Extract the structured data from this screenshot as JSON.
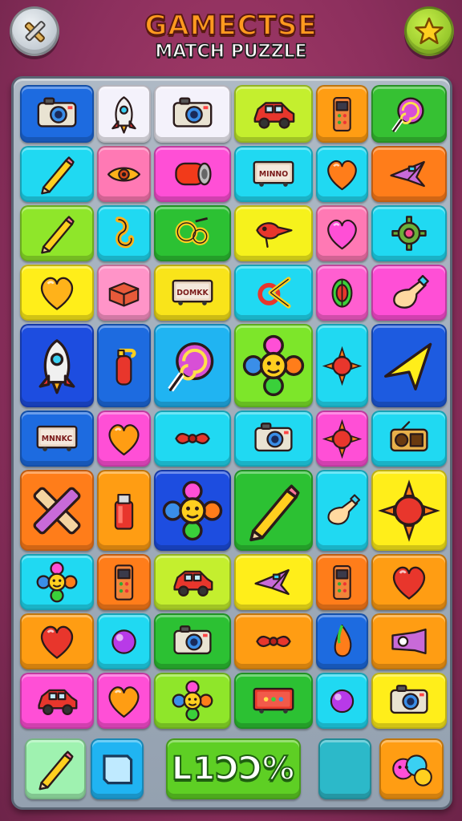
{
  "header": {
    "title": "GAMECTSE",
    "subtitle": "MATCH PUZZLE",
    "left_button_icon": "tools-icon",
    "right_button_icon": "star-icon"
  },
  "board": {
    "rows": [
      [
        {
          "icon": "camera-icon",
          "color": "#1d6be0"
        },
        {
          "icon": "rocket-icon",
          "color": "#f4f2fb"
        },
        {
          "icon": "camera-icon",
          "color": "#f4f2fb"
        },
        {
          "icon": "car-icon",
          "color": "#c4ef2e"
        },
        {
          "icon": "remote-icon",
          "color": "#ff9d13"
        },
        {
          "icon": "lollipop-icon",
          "color": "#36c133"
        }
      ],
      [
        {
          "icon": "pencil-icon",
          "color": "#20d9f2"
        },
        {
          "icon": "eye-icon",
          "color": "#ff79b4"
        },
        {
          "icon": "barrel-icon",
          "color": "#ff4fd6"
        },
        {
          "icon": "sign-icon",
          "color": "#20d9f2",
          "text": "MINNO"
        },
        {
          "icon": "heart-icon",
          "color": "#20d9f2"
        },
        {
          "icon": "plane-icon",
          "color": "#ff7d1a"
        }
      ],
      [
        {
          "icon": "pencil-icon",
          "color": "#8fe62a"
        },
        {
          "icon": "hook-icon",
          "color": "#20d9f2"
        },
        {
          "icon": "gears-icon",
          "color": "#2cc133"
        },
        {
          "icon": "bird-icon",
          "color": "#f6f21c"
        },
        {
          "icon": "heart-icon",
          "color": "#ff79b4"
        },
        {
          "icon": "gear-icon",
          "color": "#20d9f2"
        }
      ],
      [
        {
          "icon": "heart-icon",
          "color": "#ffee1a"
        },
        {
          "icon": "box-icon",
          "color": "#ff94c8"
        },
        {
          "icon": "sign-icon",
          "color": "#f9e41a",
          "text": "DOMKK"
        },
        {
          "icon": "pliers-icon",
          "color": "#20d9f2"
        },
        {
          "icon": "leaf-icon",
          "color": "#ff5fd0"
        },
        {
          "icon": "bottle-icon",
          "color": "#ff4fd6"
        }
      ],
      [
        {
          "icon": "rocket-icon",
          "color": "#1d4de0"
        },
        {
          "icon": "extinguisher-icon",
          "color": "#1d6be0"
        },
        {
          "icon": "lollipop-icon",
          "color": "#20b4f2"
        },
        {
          "icon": "flower-icon",
          "color": "#7de62a"
        },
        {
          "icon": "sun-icon",
          "color": "#20d9f2"
        },
        {
          "icon": "arrow-icon",
          "color": "#1d5be0"
        }
      ],
      [
        {
          "icon": "sign-icon",
          "color": "#1d6be0",
          "text": "MNNKC"
        },
        {
          "icon": "heart-icon",
          "color": "#ff4fd6"
        },
        {
          "icon": "bow-icon",
          "color": "#20d9f2"
        },
        {
          "icon": "camera-icon",
          "color": "#20d9f2"
        },
        {
          "icon": "sun-icon",
          "color": "#ff4fd6"
        },
        {
          "icon": "radio-icon",
          "color": "#20d9f2"
        }
      ],
      [
        {
          "icon": "tools-icon",
          "color": "#ff7d1a"
        },
        {
          "icon": "lighter-icon",
          "color": "#ff9d13"
        },
        {
          "icon": "flower-icon",
          "color": "#1d4de0"
        },
        {
          "icon": "pencil-icon",
          "color": "#2cc133"
        },
        {
          "icon": "bottle-icon",
          "color": "#20d9f2"
        },
        {
          "icon": "sun-icon",
          "color": "#ffee1a"
        }
      ],
      [
        {
          "icon": "flower-icon",
          "color": "#20d9f2"
        },
        {
          "icon": "remote-icon",
          "color": "#ff7d1a"
        },
        {
          "icon": "car-icon",
          "color": "#c4ef2e"
        },
        {
          "icon": "plane-icon",
          "color": "#ffee1a"
        },
        {
          "icon": "remote-icon",
          "color": "#ff7d1a"
        },
        {
          "icon": "heart-icon",
          "color": "#ff9d13"
        }
      ],
      [
        {
          "icon": "heart-icon",
          "color": "#ff9d13"
        },
        {
          "icon": "orb-icon",
          "color": "#20d9f2"
        },
        {
          "icon": "camera-icon",
          "color": "#2cc133"
        },
        {
          "icon": "bow-icon",
          "color": "#ff9d13"
        },
        {
          "icon": "drop-icon",
          "color": "#1d6be0"
        },
        {
          "icon": "projector-icon",
          "color": "#ff9d13"
        }
      ],
      [
        {
          "icon": "car-icon",
          "color": "#ff4fd6"
        },
        {
          "icon": "heart-icon",
          "color": "#ff4fd6"
        },
        {
          "icon": "flower-icon",
          "color": "#8fe62a"
        },
        {
          "icon": "sign-icon",
          "color": "#2cc133"
        },
        {
          "icon": "orb-icon",
          "color": "#20d9f2"
        },
        {
          "icon": "camera-icon",
          "color": "#ffee1a"
        }
      ]
    ]
  },
  "footer": {
    "progress_text": "L1ϽϽ%",
    "pencil_color": "#9ff2b0",
    "card_color": "#20b4f2",
    "progress_color": "#5ecf24",
    "blank_color": "#2cb9c9",
    "extra_color": "#ff9d13"
  }
}
